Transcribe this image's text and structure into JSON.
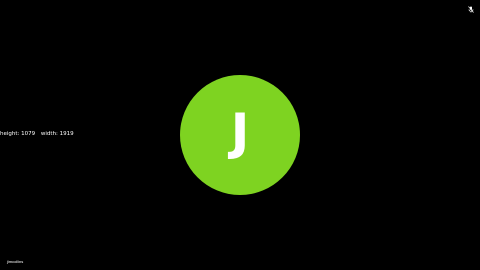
{
  "stream_info": {
    "height_label": "height:",
    "height_value": "1079",
    "width_label": "width:",
    "width_value": "1919"
  },
  "participant": {
    "initial": "J",
    "name_label": "jimcollins",
    "avatar_color": "#7ed321"
  },
  "controls": {
    "mute_icon": "microphone-muted-icon"
  }
}
